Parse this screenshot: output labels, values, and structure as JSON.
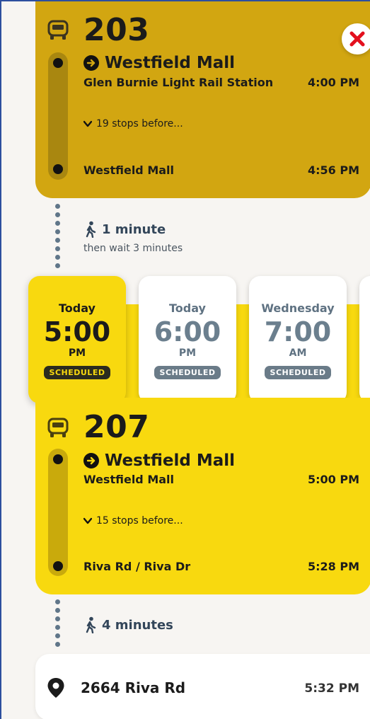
{
  "legs": [
    {
      "route": "203",
      "destination": "Westfield Mall",
      "board_stop": "Glen Burnie Light Rail Station",
      "board_time": "4:00 PM",
      "stops_toggle": "19 stops before...",
      "alight_stop": "Westfield Mall",
      "alight_time": "4:56 PM",
      "color": "#d2a611"
    },
    {
      "route": "207",
      "destination": "Westfield Mall",
      "board_stop": "Westfield Mall",
      "board_time": "5:00 PM",
      "stops_toggle": "15 stops before...",
      "alight_stop": "Riva Rd / Riva Dr",
      "alight_time": "5:28 PM",
      "color": "#f8d90f"
    }
  ],
  "walks": [
    {
      "duration": "1 minute",
      "sub": "then wait 3 minutes"
    },
    {
      "duration": "4 minutes",
      "sub": ""
    }
  ],
  "departures": [
    {
      "day": "Today",
      "time": "5:00",
      "ampm": "PM",
      "status": "SCHEDULED",
      "selected": true
    },
    {
      "day": "Today",
      "time": "6:00",
      "ampm": "PM",
      "status": "SCHEDULED",
      "selected": false
    },
    {
      "day": "Wednesday",
      "time": "7:00",
      "ampm": "AM",
      "status": "SCHEDULED",
      "selected": false
    }
  ],
  "destination": {
    "name": "2664 Riva Rd",
    "time": "5:32 PM"
  },
  "icons": [
    "bus-icon",
    "arrow-right-circle-icon",
    "chevron-down-icon",
    "walk-icon",
    "close-icon",
    "location-pin-icon"
  ],
  "colors": {
    "accent": "#f8d90f",
    "accent_dark": "#d2a611",
    "close": "#e3101e",
    "muted": "#6a7b88"
  }
}
